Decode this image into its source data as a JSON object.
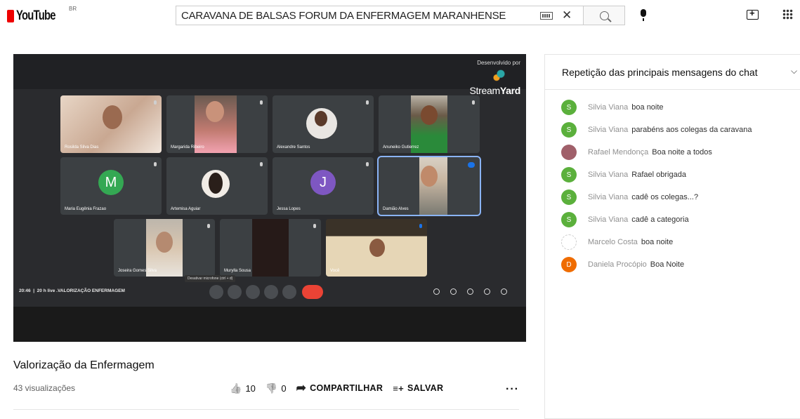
{
  "header": {
    "logo_text": "YouTube",
    "country_code": "BR",
    "search_value": "CARAVANA DE BALSAS FORUM DA ENFERMAGEM MARANHENSE",
    "icons": {
      "keyboard": "keyboard-icon",
      "clear": "close-icon",
      "search": "search-icon",
      "mic": "mic-icon",
      "create": "create-video-icon",
      "apps": "apps-grid-icon"
    },
    "clear_glyph": "✕"
  },
  "player": {
    "brand_label": "Desenvolvido por",
    "brand_name_1": "Stream",
    "brand_name_2": "Yard",
    "tiles": [
      {
        "name": "Rosilda Silva Dias"
      },
      {
        "name": "Margarida Ribeiro"
      },
      {
        "name": "Alexandre Santos"
      },
      {
        "name": "Anuneiko Gutierrez"
      },
      {
        "name": "Maria Eugênia Frazao",
        "initial": "M"
      },
      {
        "name": "Artemisa Aguiar"
      },
      {
        "name": "Jessa Lopes",
        "initial": "J"
      },
      {
        "name": "Damião Alves"
      },
      {
        "name": "Joseira Gomes Silva"
      },
      {
        "name": "Murylla Sousa"
      },
      {
        "name": "Você"
      }
    ],
    "meet_time": "20:46",
    "meet_title": "20 h live .VALORIZAÇÃO ENFERMAGEM",
    "tooltip": "Desativar microfone (ctrl + d)",
    "colors": {
      "accent_blue": "#8ab4f8",
      "end_red": "#ea4335",
      "avatar_green": "#34a853",
      "avatar_purple": "#7e57c2"
    }
  },
  "video": {
    "title": "Valorização da Enfermagem",
    "views": "43 visualizações",
    "likes": "10",
    "dislikes": "0",
    "share_label": "COMPARTILHAR",
    "save_label": "SALVAR",
    "like_glyph": "👍",
    "dislike_glyph": "👎",
    "share_glyph": "➦",
    "save_glyph": "≡+",
    "more_glyph": "···"
  },
  "chat": {
    "header_label": "Repetição das principais mensagens do chat",
    "chevron_glyph": "⌵",
    "messages": [
      {
        "initial": "S",
        "color": "#5bb03c",
        "author": "Silvia Viana",
        "text": "boa noite"
      },
      {
        "initial": "S",
        "color": "#5bb03c",
        "author": "Silvia Viana",
        "text": "parabéns aos colegas da caravana"
      },
      {
        "initial": "",
        "color": "#a0606a",
        "author": "Rafael Mendonça",
        "text": "Boa noite a todos"
      },
      {
        "initial": "S",
        "color": "#5bb03c",
        "author": "Silvia Viana",
        "text": "Rafael obrigada"
      },
      {
        "initial": "S",
        "color": "#5bb03c",
        "author": "Silvia Viana",
        "text": "cadê os colegas...?"
      },
      {
        "initial": "S",
        "color": "#5bb03c",
        "author": "Silvia Viana",
        "text": "cadê a categoria"
      },
      {
        "initial": "",
        "color": "#ffffff",
        "author": "Marcelo Costa",
        "text": "boa noite"
      },
      {
        "initial": "D",
        "color": "#ef6c00",
        "author": "Daniela Procópio",
        "text": "Boa Noite"
      }
    ]
  }
}
